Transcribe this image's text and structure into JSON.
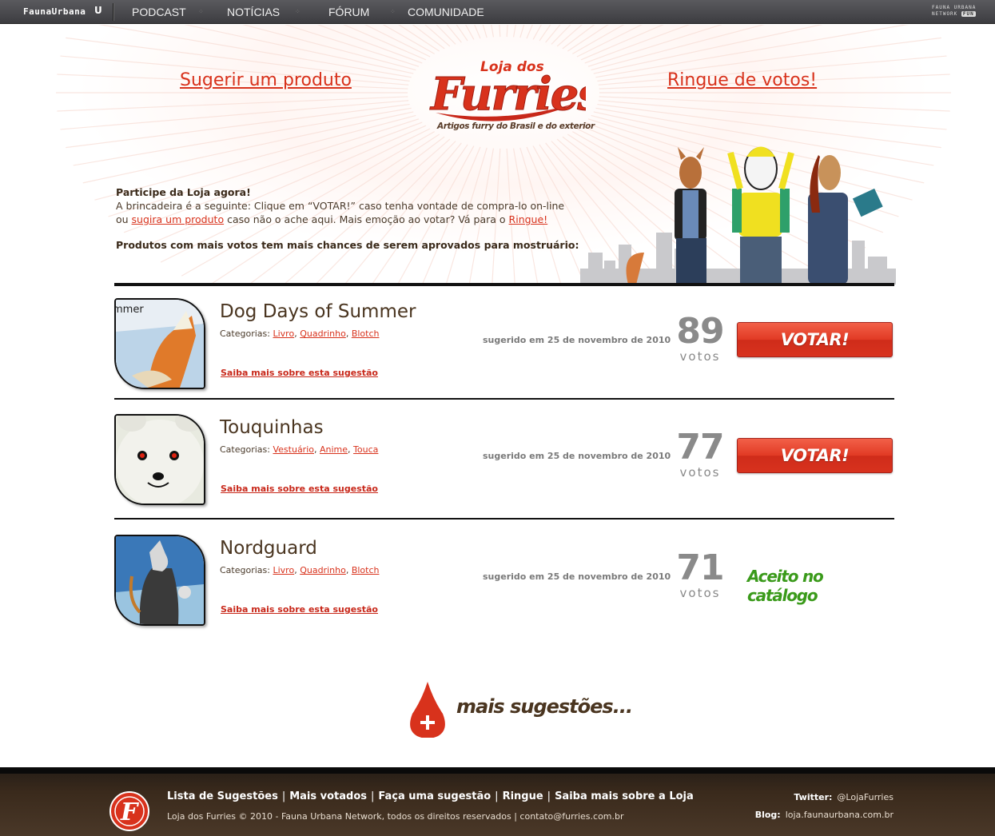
{
  "topnav": {
    "brand": "FaunaUrbana",
    "brand_mark": "U",
    "items": [
      "PODCAST",
      "NOTÍCIAS",
      "FÓRUM",
      "COMUNIDADE"
    ],
    "network_line1": "FAUNA URBANA",
    "network_line2": "NETWORK",
    "network_badge": "FUN"
  },
  "header": {
    "suggest_link": "Sugerir um produto",
    "ring_link": "Ringue de votos!",
    "logo_small": "Loja dos",
    "logo_big": "Furries",
    "tagline": "Artigos furry do Brasil e do exterior",
    "intro_title": "Participe da Loja agora!",
    "intro_line1": "A brincadeira é a seguinte: Clique em “VOTAR!” caso tenha vontade de compra-lo on-line",
    "intro_line2_pre": "ou ",
    "intro_line2_link": "sugira um produto",
    "intro_line2_mid": " caso não o ache aqui. Mais emoção ao votar? Vá para o ",
    "intro_line2_link2": "Ringue!",
    "intro_bold": "Produtos com mais votos tem mais chances de serem aprovados para mostruário:"
  },
  "products": [
    {
      "title": "Dog Days of Summer",
      "categories_label": "Categorias:",
      "categories": [
        "Livro",
        "Quadrinho",
        "Blotch"
      ],
      "more": "Saiba mais sobre esta sugestão",
      "date": "sugerido em 25 de novembro de 2010",
      "votes": "89",
      "votes_label": "votos",
      "action": "VOTAR!"
    },
    {
      "title": "Touquinhas",
      "categories_label": "Categorias:",
      "categories": [
        "Vestuário",
        "Anime",
        "Touca"
      ],
      "more": "Saiba mais sobre esta sugestão",
      "date": "sugerido em 25 de novembro de 2010",
      "votes": "77",
      "votes_label": "votos",
      "action": "VOTAR!"
    },
    {
      "title": "Nordguard",
      "categories_label": "Categorias:",
      "categories": [
        "Livro",
        "Quadrinho",
        "Blotch"
      ],
      "more": "Saiba mais sobre esta sugestão",
      "date": "sugerido em 25 de novembro de 2010",
      "votes": "71",
      "votes_label": "votos",
      "status": "Aceito no catálogo"
    }
  ],
  "more": {
    "label": "mais sugestões..."
  },
  "footer": {
    "links": [
      "Lista de Sugestões",
      "Mais votados",
      "Faça uma sugestão",
      "Ringue",
      "Saiba mais sobre a Loja"
    ],
    "copyright": "Loja dos Furries © 2010 - Fauna Urbana Network, todos os direitos reservados | contato@furries.com.br",
    "twitter_label": "Twitter:",
    "twitter_value": "@LojaFurries",
    "blog_label": "Blog:",
    "blog_value": "loja.faunaurbana.com.br"
  },
  "colors": {
    "accent": "#d8321c",
    "brown": "#4a3520",
    "accepted": "#3a9a1a",
    "footer": "#3a2a1c"
  },
  "icons": [
    "logo-f-icon",
    "blood-drop-plus-icon"
  ]
}
